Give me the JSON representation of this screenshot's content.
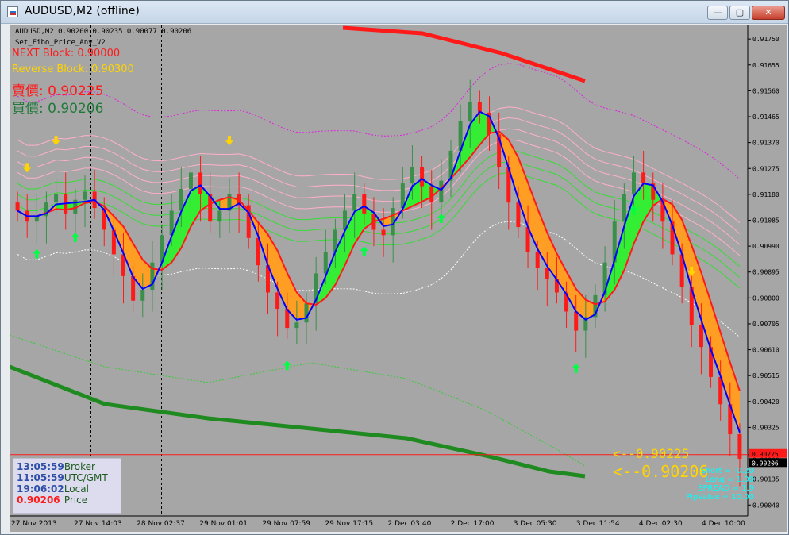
{
  "window": {
    "title": "AUDUSD,M2 (offline)",
    "buttons": {
      "minimize": "—",
      "maximize": "▢",
      "close": "✕"
    }
  },
  "header": {
    "ohlc": "AUDUSD,M2  0.90200 0.90235 0.90077 0.90206",
    "indicator": "Set_Fibo_Price_Any_V2",
    "next_block": "NEXT Block: 0.90000",
    "reverse_block": "Reverse Block: 0.90300",
    "sell": "賣價: 0.90225",
    "buy": "買價: 0.90206"
  },
  "clock_panel": [
    {
      "time": "13:05:59",
      "label": "Broker",
      "color": "#2f4fa8"
    },
    {
      "time": "11:05:59",
      "label": "UTC/GMT",
      "color": "#2f4fa8"
    },
    {
      "time": "19:06:02",
      "label": "Local",
      "color": "#2f4fa8"
    },
    {
      "time": "0.90206",
      "label": "Price",
      "color": "#ff1a1a"
    }
  ],
  "quote_labels": {
    "ask": "<--0.90225",
    "bid": "<--0.90206"
  },
  "info": [
    "Short = -0.20",
    "Long = 1.00",
    "SPREAD = 1.9",
    "PipValue = 10.00"
  ],
  "chart_data": {
    "type": "candlestick",
    "y_ticks": [
      "0.91750",
      "0.91655",
      "0.91560",
      "0.91465",
      "0.91370",
      "0.91275",
      "0.91180",
      "0.91085",
      "0.90990",
      "0.90895",
      "0.90800",
      "0.90705",
      "0.90610",
      "0.90515",
      "0.90420",
      "0.90325",
      "0.90225",
      "0.90206",
      "0.90135",
      "0.90040"
    ],
    "y_range": [
      0.9,
      0.918
    ],
    "x_labels": [
      "27 Nov 2013",
      "27 Nov 14:03",
      "28 Nov 02:37",
      "29 Nov 01:01",
      "29 Nov 07:59",
      "29 Nov 17:15",
      "2 Dec 03:40",
      "2 Dec 17:00",
      "3 Dec 05:30",
      "3 Dec 11:54",
      "4 Dec 02:30",
      "4 Dec 10:00"
    ],
    "close_series": [
      0.9112,
      0.9108,
      0.911,
      0.9115,
      0.9118,
      0.9111,
      0.9116,
      0.9119,
      0.9113,
      0.9105,
      0.9096,
      0.9088,
      0.9079,
      0.9083,
      0.9093,
      0.9103,
      0.9112,
      0.912,
      0.9126,
      0.9118,
      0.9108,
      0.9112,
      0.9118,
      0.9114,
      0.9102,
      0.9092,
      0.9082,
      0.9076,
      0.9069,
      0.9071,
      0.9078,
      0.9089,
      0.9097,
      0.9105,
      0.9112,
      0.9118,
      0.9111,
      0.9105,
      0.9103,
      0.9113,
      0.9122,
      0.9128,
      0.9121,
      0.9115,
      0.9123,
      0.9134,
      0.9145,
      0.9152,
      0.9148,
      0.914,
      0.9128,
      0.9115,
      0.9106,
      0.9097,
      0.9091,
      0.9087,
      0.9082,
      0.9075,
      0.9068,
      0.9073,
      0.9081,
      0.9093,
      0.9108,
      0.9118,
      0.9126,
      0.9122,
      0.9116,
      0.9108,
      0.9096,
      0.9084,
      0.907,
      0.9062,
      0.9051,
      0.9041,
      0.903,
      0.9021
    ],
    "last_price": 0.90206,
    "ask": 0.90225,
    "bid": 0.90206
  },
  "colors": {
    "background": "#a6a6a6",
    "bull": "#3a8f4a",
    "bear": "#ff1a1a",
    "fast_ma": "#0000ff",
    "slow_ma": "#ff1a1a",
    "fill_up": "#33ee33",
    "fill_down": "#ff9e22",
    "arrow_up": "#00ff44",
    "arrow_down": "#ffd400",
    "long_ma": "#1f8a1f"
  }
}
